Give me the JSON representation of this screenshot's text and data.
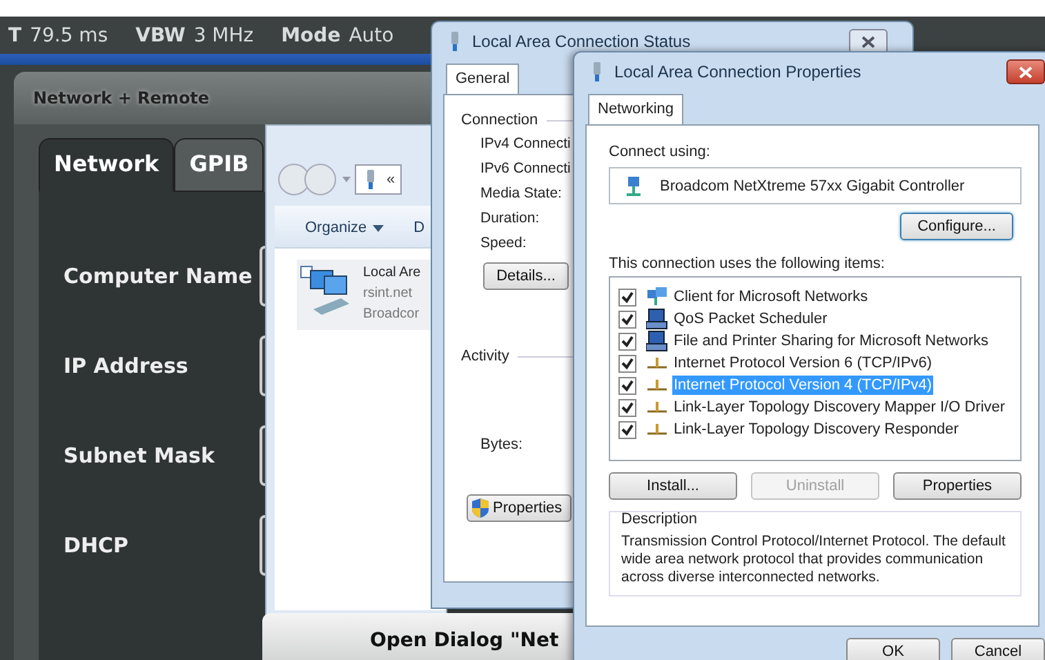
{
  "status_bar": [
    {
      "label": "T",
      "value": "79.5 ms"
    },
    {
      "label": "VBW",
      "value": "3 MHz"
    },
    {
      "label": "Mode",
      "value": "Auto"
    }
  ],
  "network_dialog": {
    "title": "Network + Remote",
    "tabs": [
      {
        "label": "Network",
        "selected": true
      },
      {
        "label": "GPIB",
        "selected": false
      }
    ],
    "fields": [
      {
        "label": "Computer Name"
      },
      {
        "label": "IP Address"
      },
      {
        "label": "Subnet Mask"
      },
      {
        "label": "DHCP"
      }
    ],
    "open_button": "Open Dialog \"Net"
  },
  "explorer": {
    "address": "«",
    "menu": [
      {
        "label": "Organize",
        "dropdown": true
      },
      {
        "label": "D",
        "dropdown": false
      }
    ],
    "items": [
      {
        "name": "Local Are",
        "details": [
          "rsint.net",
          "Broadcor"
        ]
      }
    ]
  },
  "status_window": {
    "title": "Local Area Connection Status",
    "tabs": [
      {
        "label": "General",
        "selected": true
      }
    ],
    "connection_group": "Connection",
    "rows": [
      "IPv4 Connecti",
      "IPv6 Connecti",
      "Media State:",
      "Duration:",
      "Speed:"
    ],
    "details_button": "Details...",
    "activity_group": "Activity",
    "bytes_label": "Bytes:",
    "properties_button": "Properties"
  },
  "properties_window": {
    "title": "Local Area Connection Properties",
    "tabs": [
      {
        "label": "Networking",
        "selected": true
      }
    ],
    "connect_using_label": "Connect using:",
    "adapter": "Broadcom NetXtreme 57xx Gigabit Controller",
    "configure_button": "Configure...",
    "items_label": "This connection uses the following items:",
    "items": [
      {
        "label": "Client for Microsoft Networks",
        "kind": "client",
        "checked": true,
        "selected": false
      },
      {
        "label": "QoS Packet Scheduler",
        "kind": "service",
        "checked": true,
        "selected": false
      },
      {
        "label": "File and Printer Sharing for Microsoft Networks",
        "kind": "service",
        "checked": true,
        "selected": false
      },
      {
        "label": "Internet Protocol Version 6 (TCP/IPv6)",
        "kind": "protocol",
        "checked": true,
        "selected": false
      },
      {
        "label": "Internet Protocol Version 4 (TCP/IPv4)",
        "kind": "protocol",
        "checked": true,
        "selected": true
      },
      {
        "label": "Link-Layer Topology Discovery Mapper I/O Driver",
        "kind": "protocol",
        "checked": true,
        "selected": false
      },
      {
        "label": "Link-Layer Topology Discovery Responder",
        "kind": "protocol",
        "checked": true,
        "selected": false
      }
    ],
    "buttons": [
      {
        "label": "Install...",
        "disabled": false
      },
      {
        "label": "Uninstall",
        "disabled": true
      },
      {
        "label": "Properties",
        "disabled": false
      }
    ],
    "description_group": "Description",
    "description": "Transmission Control Protocol/Internet Protocol. The default wide area network protocol that provides communication across diverse interconnected networks.",
    "dialog_buttons": [
      "OK",
      "Cancel"
    ]
  }
}
